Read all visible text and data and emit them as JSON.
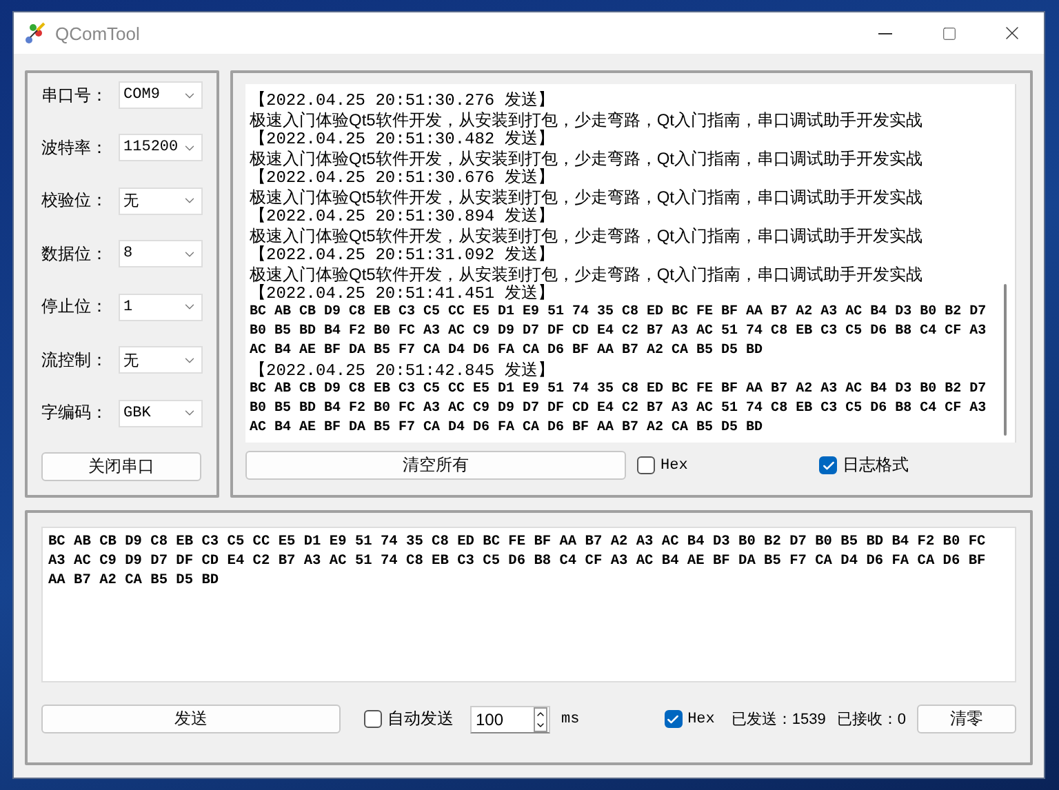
{
  "window": {
    "title": "QComTool"
  },
  "serial_settings": {
    "fields": [
      {
        "label": "串口号：",
        "value": "COM9"
      },
      {
        "label": "波特率：",
        "value": "115200"
      },
      {
        "label": "校验位：",
        "value": "无"
      },
      {
        "label": "数据位：",
        "value": "8"
      },
      {
        "label": "停止位：",
        "value": "1"
      },
      {
        "label": "流控制：",
        "value": "无"
      },
      {
        "label": "字编码：",
        "value": "GBK"
      }
    ],
    "button": "关闭串口"
  },
  "receive": {
    "log": [
      {
        "timestamp": "【2022.04.25 20:51:30.276 发送】",
        "kind": "text",
        "lines": [
          "极速入门体验Qt5软件开发，从安装到打包，少走弯路，Qt入门指南，串口调试助手开发实战"
        ]
      },
      {
        "timestamp": "【2022.04.25 20:51:30.482 发送】",
        "kind": "text",
        "lines": [
          "极速入门体验Qt5软件开发，从安装到打包，少走弯路，Qt入门指南，串口调试助手开发实战"
        ]
      },
      {
        "timestamp": "【2022.04.25 20:51:30.676 发送】",
        "kind": "text",
        "lines": [
          "极速入门体验Qt5软件开发，从安装到打包，少走弯路，Qt入门指南，串口调试助手开发实战"
        ]
      },
      {
        "timestamp": "【2022.04.25 20:51:30.894 发送】",
        "kind": "text",
        "lines": [
          "极速入门体验Qt5软件开发，从安装到打包，少走弯路，Qt入门指南，串口调试助手开发实战"
        ]
      },
      {
        "timestamp": "【2022.04.25 20:51:31.092 发送】",
        "kind": "text",
        "lines": [
          "极速入门体验Qt5软件开发，从安装到打包，少走弯路，Qt入门指南，串口调试助手开发实战"
        ]
      },
      {
        "timestamp": "【2022.04.25 20:51:41.451 发送】",
        "kind": "hex",
        "lines": [
          "BC AB CB D9 C8 EB C3 C5 CC E5 D1 E9 51 74 35 C8 ED BC FE BF AA B7 A2 A3 AC B4 D3 B0 B2 D7",
          "B0 B5 BD B4 F2 B0 FC A3 AC C9 D9 D7 DF CD E4 C2 B7 A3 AC 51 74 C8 EB C3 C5 D6 B8 C4 CF A3",
          "AC B4 AE BF DA B5 F7 CA D4 D6 FA CA D6 BF AA B7 A2 CA B5 D5 BD"
        ]
      },
      {
        "timestamp": "【2022.04.25 20:51:42.845 发送】",
        "kind": "hex",
        "lines": [
          "BC AB CB D9 C8 EB C3 C5 CC E5 D1 E9 51 74 35 C8 ED BC FE BF AA B7 A2 A3 AC B4 D3 B0 B2 D7",
          "B0 B5 BD B4 F2 B0 FC A3 AC C9 D9 D7 DF CD E4 C2 B7 A3 AC 51 74 C8 EB C3 C5 D6 B8 C4 CF A3",
          "AC B4 AE BF DA B5 F7 CA D4 D6 FA CA D6 BF AA B7 A2 CA B5 D5 BD"
        ]
      }
    ],
    "clear_button": "清空所有",
    "hex": {
      "label": "Hex",
      "checked": false
    },
    "log_format": {
      "label": "日志格式",
      "checked": true
    }
  },
  "send": {
    "text": "BC AB CB D9 C8 EB C3 C5 CC E5 D1 E9 51 74 35 C8 ED BC FE BF AA B7 A2 A3 AC B4 D3 B0 B2 D7 B0 B5 BD B4 F2 B0 FC A3 AC C9 D9 D7 DF CD E4 C2 B7 A3 AC 51 74 C8 EB C3 C5 D6 B8 C4 CF A3 AC B4 AE BF DA B5 F7 CA D4 D6 FA CA D6 BF AA B7 A2 CA B5 D5 BD",
    "send_button": "发送",
    "auto_send": {
      "label": "自动发送",
      "checked": false
    },
    "interval": "100",
    "unit": "ms",
    "hex": {
      "label": "Hex",
      "checked": true
    },
    "sent": "已发送：1539",
    "received": "已接收：0",
    "clear_button": "清零"
  }
}
